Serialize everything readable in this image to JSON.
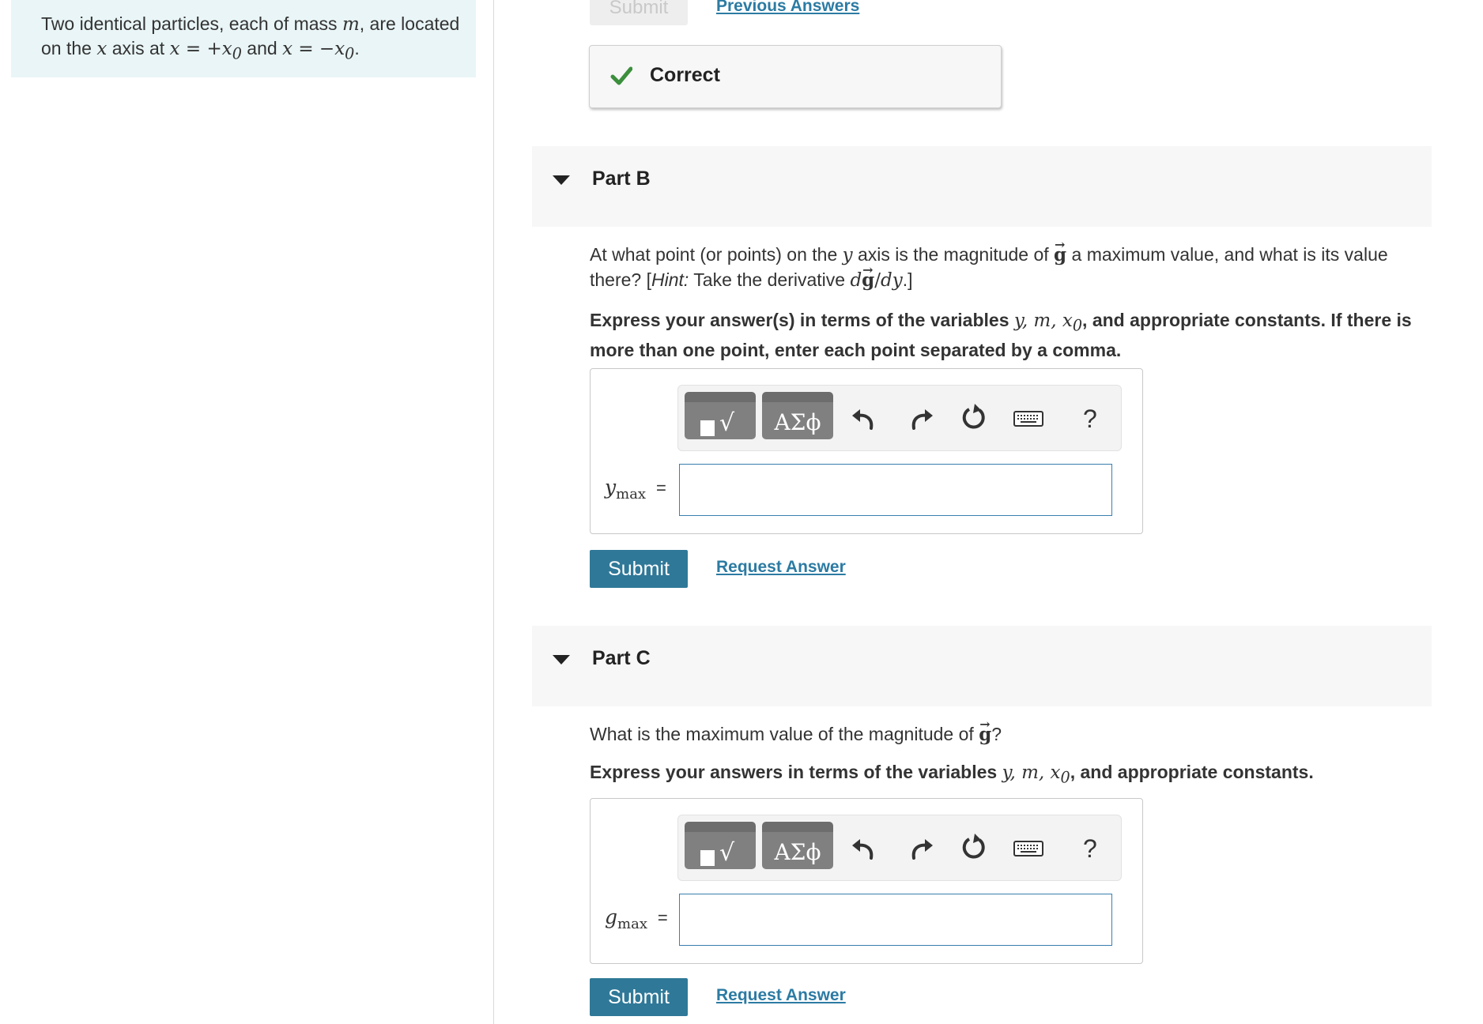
{
  "problem": {
    "text_prefix": "Two identical particles, each of mass ",
    "mass_var": "m",
    "text_mid1": ", are located on the ",
    "axis_var": "x",
    "text_mid2": " axis at ",
    "eq1": "x = +x",
    "eq1_sub": "0",
    "text_mid3": " and ",
    "eq2": "x = −x",
    "eq2_sub": "0",
    "text_end": "."
  },
  "part_a": {
    "submit_label": "Submit",
    "previous_answers_label": "Previous Answers",
    "feedback_label": "Correct"
  },
  "part_b": {
    "title": "Part B",
    "question": {
      "p1": "At what point (or points) on the ",
      "y": "y",
      "p2": " axis is the magnitude of ",
      "g": "g",
      "p3": " a maximum value, and what is its value there? [",
      "hint": "Hint:",
      "p4": " Take the derivative ",
      "d1": "d",
      "g2": "g",
      "slash": "/",
      "dy": "dy",
      "p5": ".]"
    },
    "instruction": {
      "p1": "Express your answer(s) in terms of the variables ",
      "vars": "y, m, x",
      "sub": "0",
      "p2": ", and appropriate constants. If there is more than one point, enter each point separated by a comma."
    },
    "toolbar": {
      "greek_label": "ΑΣϕ",
      "help_label": "?"
    },
    "variable": "y",
    "variable_sub": "max",
    "equals": "=",
    "input_value": "",
    "submit_label": "Submit",
    "request_answer_label": "Request Answer"
  },
  "part_c": {
    "title": "Part C",
    "question": {
      "p1": "What is the maximum value of the magnitude of ",
      "g": "g",
      "p2": "?"
    },
    "instruction": {
      "p1": "Express your answers in terms of the variables ",
      "vars": "y, m, x",
      "sub": "0",
      "p2": ", and appropriate constants."
    },
    "toolbar": {
      "greek_label": "ΑΣϕ",
      "help_label": "?"
    },
    "variable": "g",
    "variable_sub": "max",
    "equals": "=",
    "input_value": "",
    "submit_label": "Submit",
    "request_answer_label": "Request Answer"
  },
  "colors": {
    "problem_bg": "#e9f5f6",
    "submit_bg": "#2f7898",
    "link": "#2c7ba3",
    "check": "#3c8f3c",
    "input_border": "#3a7fae"
  }
}
